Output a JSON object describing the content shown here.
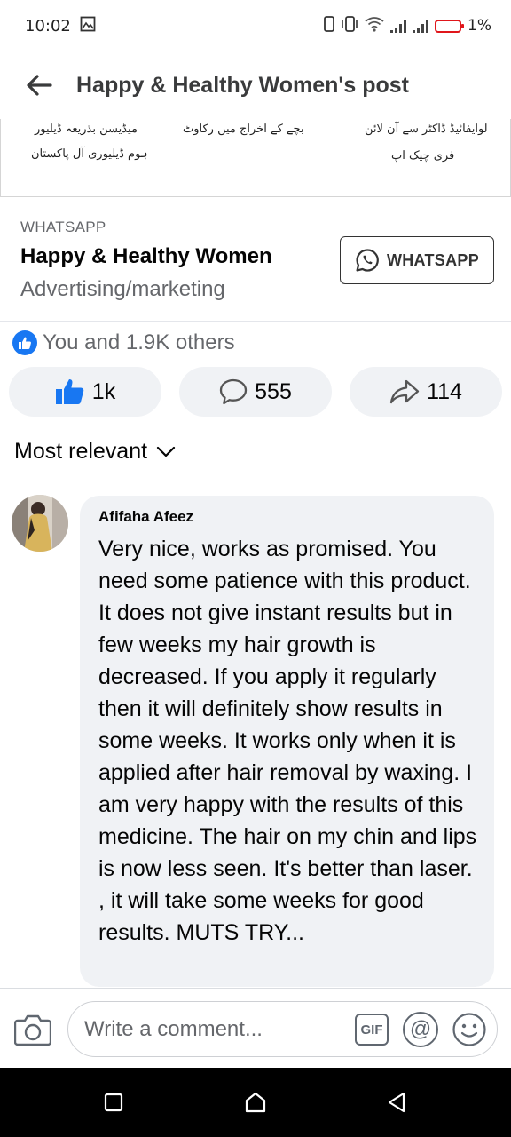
{
  "status_bar": {
    "time": "10:02",
    "battery_percent": "1%",
    "battery_color": "#e0161b"
  },
  "header": {
    "title": "Happy & Healthy Women's post",
    "back_icon": "arrow-left-icon"
  },
  "ad_image": {
    "texts": [
      "میڈیسن بذریعہ ڈیلیور",
      "ہوم ڈیلیوری آل پاکستان",
      "بچے کے اخراج میں رکاوٹ",
      "لوایفائیڈ ڈاکٹر سے آن لائن",
      "فری چیک اپ"
    ]
  },
  "whatsapp_card": {
    "caption": "WHATSAPP",
    "page_name": "Happy & Healthy Women",
    "category": "Advertising/marketing",
    "button_label": "WHATSAPP",
    "button_icon": "whatsapp-icon"
  },
  "reactions": {
    "summary": "You and 1.9K others",
    "badge_icon": "like-icon",
    "badge_color": "#1877f2"
  },
  "actions": {
    "like_count": "1k",
    "comment_count": "555",
    "share_count": "114"
  },
  "sort": {
    "label": "Most relevant"
  },
  "comment": {
    "author": "Afifaha Afeez",
    "text": "Very nice, works as promised. You need some patience with this product. It does not give instant results but in few weeks my hair growth is decreased. If you apply it regularly then it will definitely show results in some weeks. It works only when it is applied after hair removal by waxing. I am very happy with the results of this medicine. The hair on my chin and lips is now less seen. It's better than laser. , it will take some weeks for good results. MUTS TRY..."
  },
  "composer": {
    "placeholder": "Write a comment...",
    "gif_label": "GIF",
    "mention_label": "@"
  },
  "colors": {
    "accent": "#1877f2",
    "pill_bg": "#f0f2f5",
    "secondary_text": "#65676b"
  }
}
